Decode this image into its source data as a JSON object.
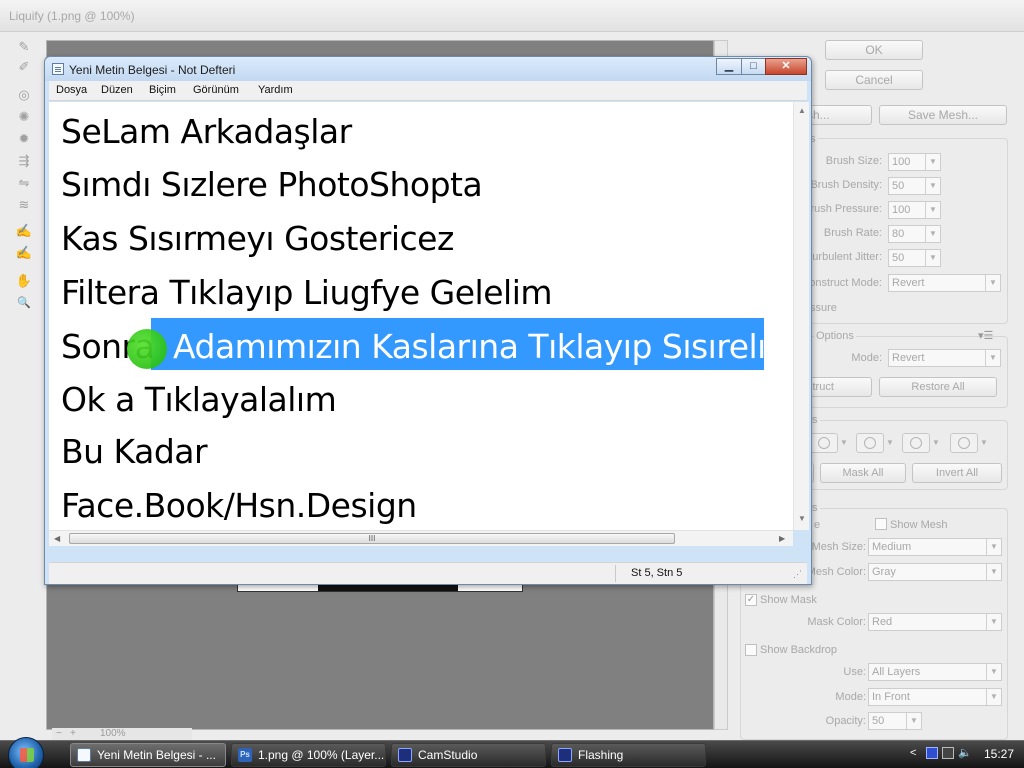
{
  "liquify": {
    "title": "Liquify (1.png @ 100%)",
    "tools": [
      {
        "icon": "forward-warp-icon",
        "glyph": "✎"
      },
      {
        "icon": "reconstruct-icon",
        "glyph": "✐"
      },
      {
        "icon": "twirl-icon",
        "glyph": "◎"
      },
      {
        "icon": "pucker-icon",
        "glyph": "✺"
      },
      {
        "icon": "bloat-icon",
        "glyph": "✹"
      },
      {
        "icon": "push-left-icon",
        "glyph": "⇶"
      },
      {
        "icon": "mirror-icon",
        "glyph": "⇋"
      },
      {
        "icon": "turbulence-icon",
        "glyph": "≋"
      },
      {
        "icon": "freeze-mask-icon",
        "glyph": "✍"
      },
      {
        "icon": "thaw-mask-icon",
        "glyph": "✍"
      },
      {
        "icon": "hand-icon",
        "glyph": "✋"
      },
      {
        "icon": "zoom-icon",
        "glyph": "🔍"
      }
    ],
    "zoom": {
      "minus": "−",
      "plus": "+",
      "value": "100%"
    },
    "buttons": {
      "ok": "OK",
      "cancel": "Cancel",
      "load_mesh": "sh...",
      "save_mesh": "Save Mesh..."
    },
    "tool_options": {
      "section": "s",
      "brush_size": {
        "label": "Brush Size:",
        "value": "100"
      },
      "brush_density": {
        "label": "Brush Density:",
        "value": "50"
      },
      "brush_pressure": {
        "label": "Brush Pressure:",
        "value": "100"
      },
      "brush_rate": {
        "label": "Brush Rate:",
        "value": "80"
      },
      "turbulent_jitter": {
        "label": "urbulent Jitter:",
        "value": "50"
      },
      "reconstruct_mode": {
        "label": "onstruct Mode:",
        "value": "Revert"
      },
      "stylus_pressure": "ssure"
    },
    "reconstruct_options": {
      "header": "Options",
      "mode_label": "Mode:",
      "mode_value": "Revert",
      "reconstruct": "struct",
      "restore_all": "Restore All"
    },
    "mask_options": {
      "header": "s",
      "mask_none": "",
      "mask_all": "Mask All",
      "invert_all": "Invert All"
    },
    "view_options": {
      "header": "s",
      "image_label": "e",
      "show_mesh": "Show Mesh",
      "mesh_size_label": "Mesh Size:",
      "mesh_size_value": "Medium",
      "mesh_color_label": "Mesh Color:",
      "mesh_color_value": "Gray",
      "show_mask": "Show Mask",
      "show_mask_checked": "✓",
      "mask_color_label": "Mask Color:",
      "mask_color_value": "Red",
      "show_backdrop": "Show Backdrop",
      "use_label": "Use:",
      "use_value": "All Layers",
      "mode_label": "Mode:",
      "mode_value": "In Front",
      "opacity_label": "Opacity:",
      "opacity_value": "50"
    }
  },
  "notepad": {
    "title": "Yeni Metin Belgesi - Not Defteri",
    "controls": {
      "minimize": "▁",
      "maximize": "□",
      "close": "✕"
    },
    "menu": [
      "Dosya",
      "Düzen",
      "Biçim",
      "Görünüm",
      "Yardım"
    ],
    "lines": [
      "SeLam Arkadaşlar",
      "Sımdı Sızlere PhotoShopta",
      "Kas Sısırmeyı Gostericez",
      "Filtera Tıklayıp Liugfye Gelelim",
      "Sonra",
      "Ok a Tıklayalalım",
      "Bu Kadar",
      "Face.Book/Hsn.Design"
    ],
    "selected_text": "Adamımızın Kaslarına Tıklayıp Sısırelım",
    "status": "St 5, Stn 5",
    "hscroll_grip": "III"
  },
  "taskbar": {
    "items": [
      {
        "label": "Yeni Metin Belgesi - ...",
        "icon": "notepad-icon"
      },
      {
        "label": "1.png @ 100% (Layer...",
        "icon": "photoshop-icon"
      },
      {
        "label": "CamStudio",
        "icon": "camstudio-icon"
      },
      {
        "label": "Flashing",
        "icon": "flashing-icon"
      }
    ],
    "tray_chevron": "<",
    "clock": "15:27"
  },
  "colors": {
    "selection": "#3399ff",
    "cursor_highlight": "#22c014",
    "photoshop_icon": "#2d63b8"
  }
}
